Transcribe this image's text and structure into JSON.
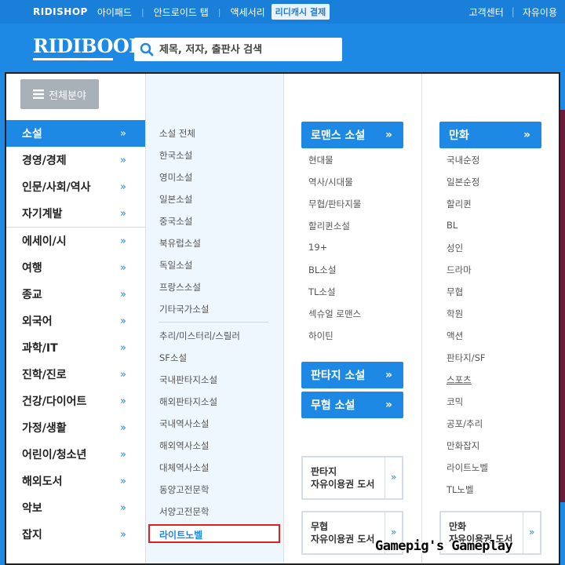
{
  "topbar": {
    "logo": "RIDISHOP",
    "links": [
      "아이패드",
      "안드로이드 탭",
      "액세서리"
    ],
    "cash_label": "리디캐시 결제",
    "right_links": [
      "고객센터",
      "자유이용"
    ]
  },
  "header": {
    "brand": "RIDIBOOKS",
    "search_placeholder": "제목, 저자, 출판사 검색"
  },
  "menu": {
    "all_button": "전체분야",
    "categories": [
      {
        "label": "소설",
        "active": true
      },
      {
        "label": "경영/경제"
      },
      {
        "label": "인문/사회/역사"
      },
      {
        "label": "자기계발"
      },
      {
        "label": "에세이/시"
      },
      {
        "label": "여행"
      },
      {
        "label": "종교"
      },
      {
        "label": "외국어"
      },
      {
        "label": "과학/IT"
      },
      {
        "label": "진학/진로"
      },
      {
        "label": "건강/다이어트"
      },
      {
        "label": "가정/생활"
      },
      {
        "label": "어린이/청소년"
      },
      {
        "label": "해외도서"
      },
      {
        "label": "악보"
      },
      {
        "label": "잡지"
      }
    ],
    "arrow": "»",
    "subcategories_a": [
      "소설 전체",
      "한국소설",
      "영미소설",
      "일본소설",
      "중국소설",
      "북유럽소설",
      "독일소설",
      "프랑스소설",
      "기타국가소설"
    ],
    "subcategories_b": [
      "추리/미스터리/스릴러",
      "SF소설",
      "국내판타지소설",
      "해외판타지소설",
      "국내역사소설",
      "해외역사소설",
      "대체역사소설",
      "동양고전문학",
      "서양고전문학"
    ],
    "highlighted_sub": "라이트노벨",
    "romance": {
      "title": "로맨스 소설",
      "items": [
        "현대물",
        "역사/시대물",
        "무협/판타지물",
        "할리퀸소설",
        "19+",
        "BL소설",
        "TL소설",
        "섹슈얼 로맨스",
        "하이틴"
      ]
    },
    "fantasy_title": "판타지 소설",
    "martial_title": "무협 소설",
    "free_boxes": [
      {
        "line1": "판타지",
        "line2": "자유이용권 도서"
      },
      {
        "line1": "무협",
        "line2": "자유이용권 도서"
      }
    ],
    "comics": {
      "title": "만화",
      "items": [
        "국내순정",
        "일본순정",
        "할리퀸",
        "BL",
        "성인",
        "드라마",
        "무협",
        "학원",
        "액션",
        "판타지/SF",
        "스포츠",
        "코믹",
        "공포/추리",
        "만화잡지",
        "라이트노벨",
        "TL노벨"
      ]
    },
    "comic_free_box": {
      "line1": "만화",
      "line2": "자유이용권 도서"
    }
  },
  "watermark": "Gamepig's Gameplay",
  "colors": {
    "brand_blue": "#1e88e5",
    "highlight_red": "#e02020",
    "all_button_gray": "#a8b0b8"
  }
}
